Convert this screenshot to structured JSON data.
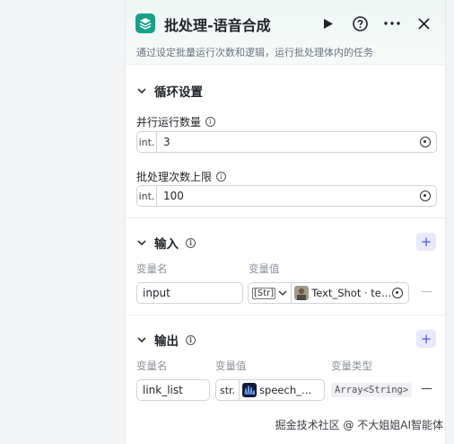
{
  "header": {
    "title": "批处理-语音合成",
    "subtitle": "通过设定批量运行次数和逻辑，运行批处理体内的任务"
  },
  "loop_section": {
    "title": "循环设置",
    "parallel": {
      "label": "并行运行数量",
      "type": "int.",
      "value": "3"
    },
    "limit": {
      "label": "批处理次数上限",
      "type": "int.",
      "value": "100"
    }
  },
  "input_section": {
    "title": "输入",
    "col_name": "变量名",
    "col_value": "变量值",
    "row": {
      "name": "input",
      "type_chip": "[Str]",
      "ref_text": "Text_Shot · te…"
    }
  },
  "output_section": {
    "title": "输出",
    "col_name": "变量名",
    "col_value": "变量值",
    "col_type": "变量类型",
    "row": {
      "name": "link_list",
      "type": "str.",
      "ref_text": "speech_…",
      "var_type": "Array<String>"
    }
  },
  "watermark": "掘金技术社区 @ 不大姐姐AI智能体",
  "colors": {
    "accent": "#4d53e8",
    "brand": "#19a08c"
  }
}
